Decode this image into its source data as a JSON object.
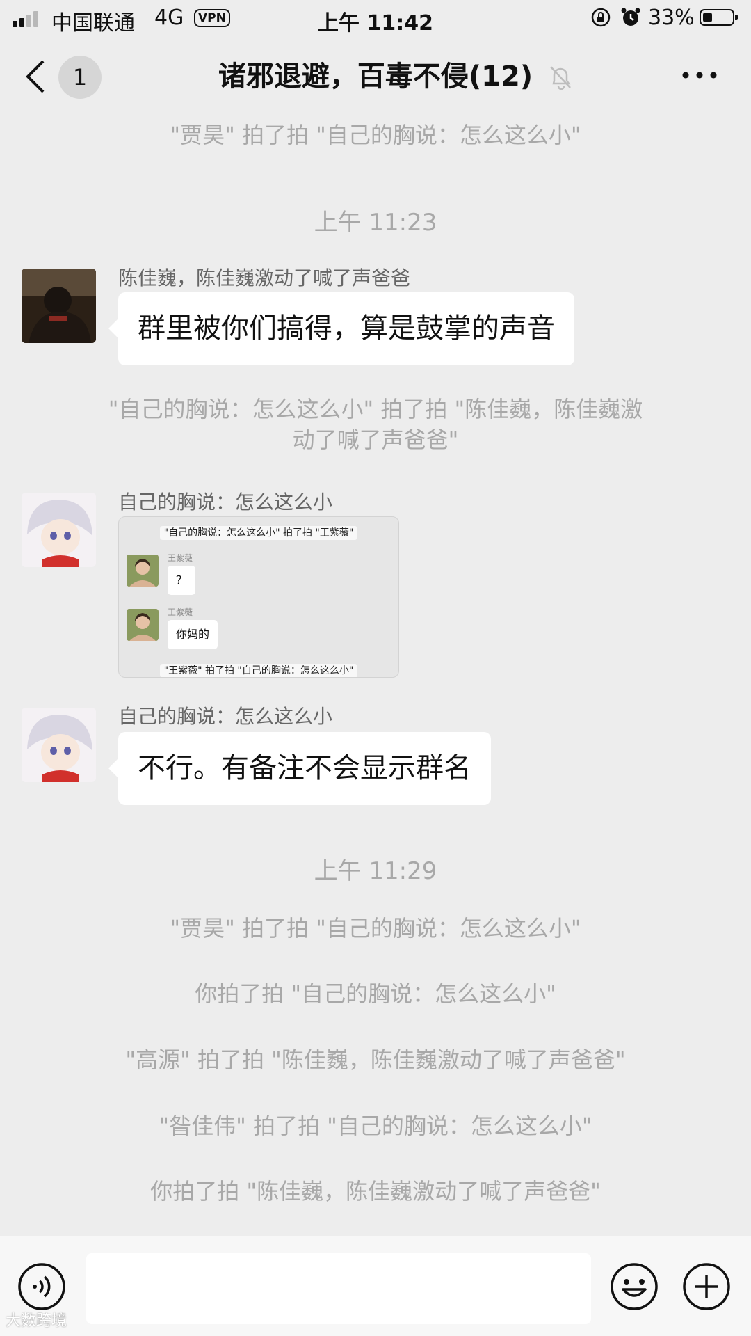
{
  "status_bar": {
    "carrier": "中国联通",
    "network": "4G",
    "vpn": "VPN",
    "time": "上午 11:42",
    "battery": "33%",
    "battery_level": 0.33
  },
  "nav": {
    "unread_count": "1",
    "title": "诸邪退避，百毒不侵(12)"
  },
  "chat": {
    "sys_top": "\"贾昊\" 拍了拍 \"自己的胸说：怎么这么小\"",
    "time_1": "上午 11:23",
    "msg1_sender": "陈佳巍，陈佳巍激动了喊了声爸爸",
    "msg1_text": "群里被你们搞得，算是鼓掌的声音",
    "sys_pat_line1": "\"自己的胸说：怎么这么小\" 拍了拍 \"陈佳巍，陈佳巍激",
    "sys_pat_line2": "动了喊了声爸爸\"",
    "msg2_sender": "自己的胸说：怎么这么小",
    "msg2_image": {
      "sys_top": "\"自己的胸说：怎么这么小\" 拍了拍 \"王紫薇\"",
      "name1": "王紫薇",
      "bubble1": "？",
      "name2": "王紫薇",
      "bubble2": "你妈的",
      "sys_bottom": "\"王紫薇\" 拍了拍 \"自己的胸说：怎么这么小\""
    },
    "msg3_sender": "自己的胸说：怎么这么小",
    "msg3_text": "不行。有备注不会显示群名",
    "time_2": "上午 11:29",
    "sys_list": [
      "\"贾昊\" 拍了拍 \"自己的胸说：怎么这么小\"",
      "你拍了拍 \"自己的胸说：怎么这么小\"",
      "\"高源\" 拍了拍 \"陈佳巍，陈佳巍激动了喊了声爸爸\"",
      "\"昝佳伟\" 拍了拍 \"自己的胸说：怎么这么小\"",
      "你拍了拍 \"陈佳巍，陈佳巍激动了喊了声爸爸\""
    ]
  },
  "watermark": "大数跨境",
  "icons": {
    "back": "chevron-left-icon",
    "mute": "bell-off-icon",
    "more": "more-dots-icon",
    "voice": "voice-icon",
    "emoji": "emoji-icon",
    "plus": "plus-icon"
  }
}
